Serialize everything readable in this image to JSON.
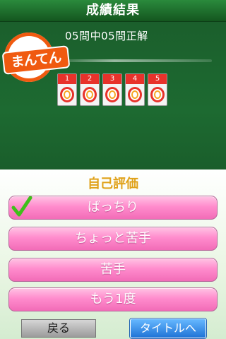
{
  "header": {
    "title": "成績結果"
  },
  "result": {
    "summary": "05問中05問正解",
    "stamp": "まんてん",
    "cards": [
      {
        "number": "1",
        "mark": "circle-mark"
      },
      {
        "number": "2",
        "mark": "circle-mark"
      },
      {
        "number": "3",
        "mark": "circle-mark"
      },
      {
        "number": "4",
        "mark": "circle-mark"
      },
      {
        "number": "5",
        "mark": "circle-mark"
      }
    ]
  },
  "evaluation": {
    "title": "自己評価",
    "options": [
      {
        "label": "ばっちり",
        "selected": true
      },
      {
        "label": "ちょっと苦手",
        "selected": false
      },
      {
        "label": "苦手",
        "selected": false
      },
      {
        "label": "もう1度",
        "selected": false
      }
    ]
  },
  "footer": {
    "back_label": "戻る",
    "title_label": "タイトルへ"
  },
  "colors": {
    "accent_orange": "#f05a10",
    "pink_button": "#ff8ccd",
    "check_green": "#3fbf1a",
    "blue_button": "#1f73d6"
  }
}
